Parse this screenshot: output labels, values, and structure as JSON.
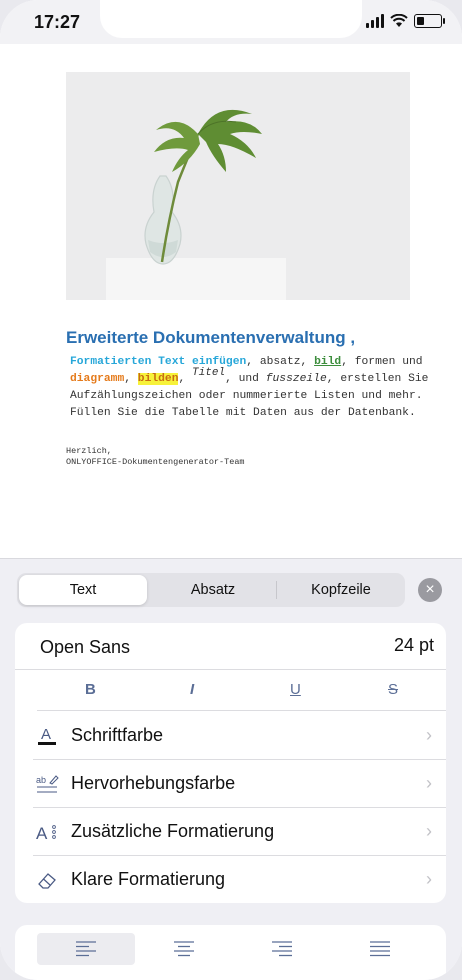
{
  "status": {
    "time": "17:27"
  },
  "document": {
    "title": "Erweiterte Dokumentenverwaltung",
    "title_comma": ",",
    "p1": "Formatierten Text einfügen",
    "p2": ",  absatz, ",
    "p3": "bild",
    "p4": ", formen und",
    "p5": "diagramm",
    "p6": ", ",
    "p7": "bilden",
    "p8": ", ",
    "p9": "Titel",
    "p10": ", und ",
    "p11": "fusszeile",
    "p12": ", erstellen Sie",
    "p13": "Aufzählungszeichen oder nummerierte Listen und mehr.",
    "p14": "Füllen Sie die Tabelle mit Daten aus der Datenbank.",
    "sig1": "Herzlich,",
    "sig2": "ONLYOFFICE-Dokumentengenerator-Team"
  },
  "tabs": [
    "Text",
    "Absatz",
    "Kopfzeile"
  ],
  "close_label": "×",
  "font": {
    "name": "Open Sans",
    "size": "24 pt"
  },
  "styles": {
    "bold": "B",
    "italic": "I",
    "underline": "U",
    "strike": "S"
  },
  "menu": [
    {
      "label": "Schriftfarbe",
      "icon": "font-color-icon"
    },
    {
      "label": "Hervorhebungsfarbe",
      "icon": "highlight-icon"
    },
    {
      "label": "Zusätzliche Formatierung",
      "icon": "additional-format-icon"
    },
    {
      "label": "Klare Formatierung",
      "icon": "eraser-icon"
    }
  ],
  "chevron": "›",
  "alignment": [
    "align-left-icon",
    "align-center-icon",
    "align-right-icon",
    "align-justify-icon"
  ],
  "colors": {
    "accent": "#5b6e96",
    "title_blue": "#2a6fb1",
    "highlight": "#f7f23a"
  }
}
